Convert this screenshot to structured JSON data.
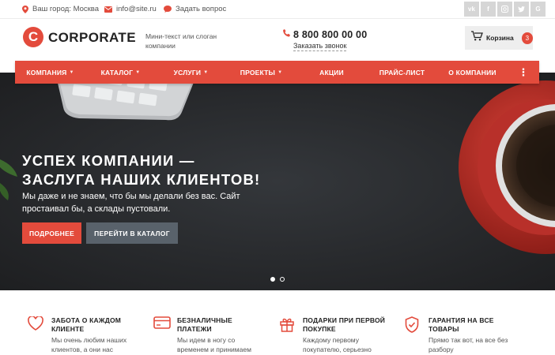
{
  "topbar": {
    "city": "Ваш город: Москва",
    "email": "info@site.ru",
    "ask": "Задать вопрос",
    "socials": [
      "vk",
      "fb",
      "ig",
      "tw",
      "g"
    ]
  },
  "header": {
    "logo_letter": "C",
    "logo_text": "CORPORATE",
    "slogan": "Мини-текст или слоган компании",
    "phone": "8 800 800 00 00",
    "callback": "Заказать звонок",
    "cart_label": "Корзина",
    "cart_count": "3"
  },
  "nav": {
    "items": [
      {
        "label": "КОМПАНИЯ",
        "has_dropdown": true
      },
      {
        "label": "КАТАЛОГ",
        "has_dropdown": true
      },
      {
        "label": "УСЛУГИ",
        "has_dropdown": true
      },
      {
        "label": "ПРОЕКТЫ",
        "has_dropdown": true
      },
      {
        "label": "АКЦИИ",
        "has_dropdown": false
      },
      {
        "label": "ПРАЙС-ЛИСТ",
        "has_dropdown": false
      },
      {
        "label": "О КОМПАНИИ",
        "has_dropdown": false
      }
    ],
    "more": "⋮"
  },
  "hero": {
    "title_line1": "УСПЕХ КОМПАНИИ —",
    "title_line2": "ЗАСЛУГА НАШИХ КЛИЕНТОВ!",
    "text": "Мы даже и не знаем, что бы мы делали без вас. Сайт простаивал бы, а склады пустовали.",
    "btn_primary": "ПОДРОБНЕЕ",
    "btn_secondary": "ПЕРЕЙТИ В КАТАЛОГ",
    "slides": 2,
    "active_slide": 1
  },
  "features": [
    {
      "icon": "heart-icon",
      "title": "ЗАБОТА О КАЖДОМ КЛИЕНТЕ",
      "desc": "Мы очень любим наших клиентов, а они нас"
    },
    {
      "icon": "credit-card-icon",
      "title": "БЕЗНАЛИЧНЫЕ ПЛАТЕЖИ",
      "desc": "Мы идем в ногу со временем и принимаем"
    },
    {
      "icon": "gift-icon",
      "title": "ПОДАРКИ ПРИ ПЕРВОЙ ПОКУПКЕ",
      "desc": "Каждому первому покупателю, серьезно"
    },
    {
      "icon": "shield-check-icon",
      "title": "ГАРАНТИЯ НА ВСЕ ТОВАРЫ",
      "desc": "Прямо так вот, на все без разбору"
    }
  ],
  "colors": {
    "accent": "#e34b3c",
    "hero_bg": "#2b2d30",
    "secondary_button": "#59626b"
  }
}
